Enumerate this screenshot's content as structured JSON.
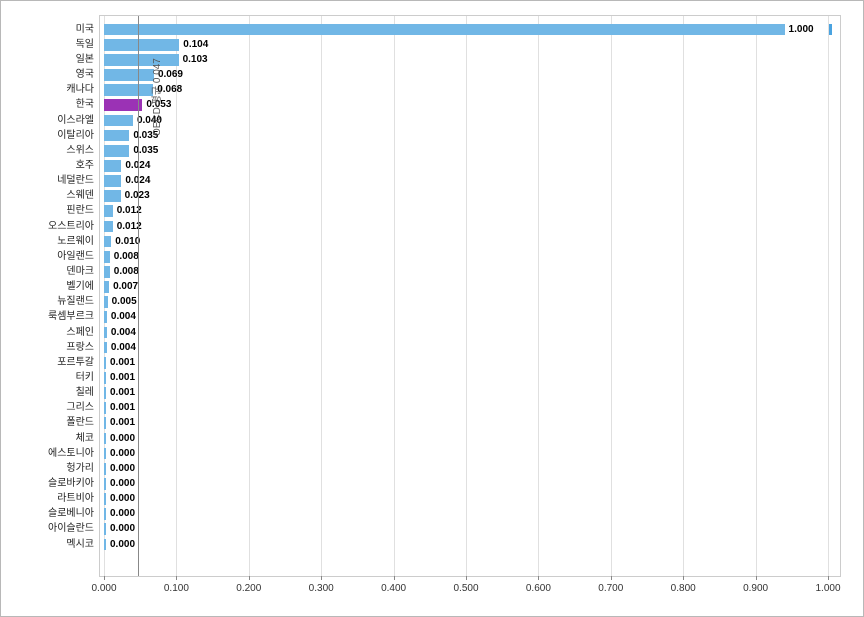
{
  "chart_data": {
    "type": "bar",
    "orientation": "horizontal",
    "title": "",
    "xlabel": "",
    "ylabel": "",
    "xlim": [
      0,
      1.0
    ],
    "x_ticks": [
      0.0,
      0.1,
      0.2,
      0.3,
      0.4,
      0.5,
      0.6,
      0.7,
      0.8,
      0.9,
      1.0
    ],
    "reference_line": {
      "label": "OECD 평균",
      "value": 0.047
    },
    "highlight_category": "한국",
    "end_marker": {
      "value": 1.0,
      "width": 0.004
    },
    "series": [
      {
        "category": "미국",
        "value": 1.0
      },
      {
        "category": "독일",
        "value": 0.104
      },
      {
        "category": "일본",
        "value": 0.103
      },
      {
        "category": "영국",
        "value": 0.069
      },
      {
        "category": "캐나다",
        "value": 0.068
      },
      {
        "category": "한국",
        "value": 0.053
      },
      {
        "category": "이스라엘",
        "value": 0.04
      },
      {
        "category": "이탈리아",
        "value": 0.035
      },
      {
        "category": "스위스",
        "value": 0.035
      },
      {
        "category": "호주",
        "value": 0.024
      },
      {
        "category": "네덜란드",
        "value": 0.024
      },
      {
        "category": "스웨덴",
        "value": 0.023
      },
      {
        "category": "핀란드",
        "value": 0.012
      },
      {
        "category": "오스트리아",
        "value": 0.012
      },
      {
        "category": "노르웨이",
        "value": 0.01
      },
      {
        "category": "아일랜드",
        "value": 0.008
      },
      {
        "category": "덴마크",
        "value": 0.008
      },
      {
        "category": "벨기에",
        "value": 0.007
      },
      {
        "category": "뉴질랜드",
        "value": 0.005
      },
      {
        "category": "룩셈부르크",
        "value": 0.004
      },
      {
        "category": "스페인",
        "value": 0.004
      },
      {
        "category": "프랑스",
        "value": 0.004
      },
      {
        "category": "포르투갈",
        "value": 0.001
      },
      {
        "category": "터키",
        "value": 0.001
      },
      {
        "category": "칠레",
        "value": 0.001
      },
      {
        "category": "그리스",
        "value": 0.001
      },
      {
        "category": "폴란드",
        "value": 0.001
      },
      {
        "category": "체코",
        "value": 0.0
      },
      {
        "category": "에스토니아",
        "value": 0.0
      },
      {
        "category": "헝가리",
        "value": 0.0
      },
      {
        "category": "슬로바키아",
        "value": 0.0
      },
      {
        "category": "라트비아",
        "value": 0.0
      },
      {
        "category": "슬로베니아",
        "value": 0.0
      },
      {
        "category": "아이슬란드",
        "value": 0.0
      },
      {
        "category": "멕시코",
        "value": 0.0
      }
    ]
  }
}
